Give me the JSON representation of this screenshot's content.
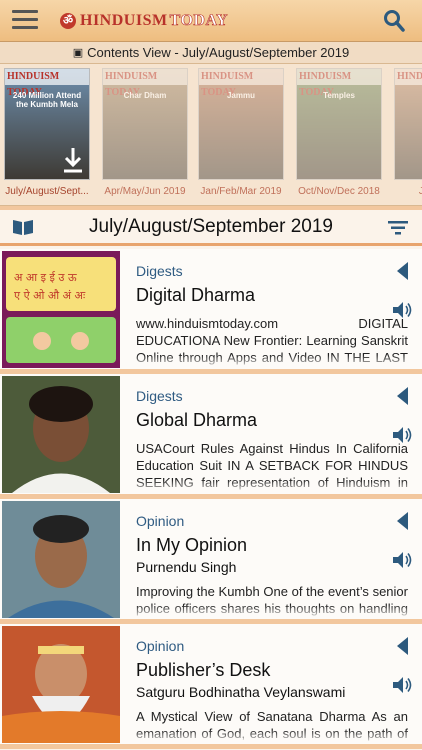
{
  "header": {
    "logo_text_1": "HINDUISM",
    "logo_text_2": "TODAY",
    "logo_mark": "ॐ",
    "menu_icon": "hamburger-icon",
    "search_icon": "search-icon"
  },
  "view_bar": {
    "label": "Contents View - July/August/September 2019",
    "icon": "monitor-icon"
  },
  "issues": [
    {
      "label": "July/August/Sept...",
      "masthead": "HINDUISM TODAY",
      "cover_title": "240 Million Attend the Kumbh Mela",
      "cover_color": "#6e8fae",
      "state": "active"
    },
    {
      "label": "Apr/May/Jun 2019",
      "masthead": "HINDUISM TODAY",
      "cover_title": "Char Dham",
      "cover_color": "#a78c6a",
      "state": "faded"
    },
    {
      "label": "Jan/Feb/Mar 2019",
      "masthead": "HINDUISM TODAY",
      "cover_title": "Jammu",
      "cover_color": "#b77a5a",
      "state": "faded"
    },
    {
      "label": "Oct/Nov/Dec 2018",
      "masthead": "HINDUISM TODAY",
      "cover_title": "Temples",
      "cover_color": "#6f8f5c",
      "state": "faded"
    },
    {
      "label": "Jul/Au...",
      "masthead": "HINDU",
      "cover_title": "",
      "cover_color": "#c09070",
      "state": "faded"
    }
  ],
  "issue_title": "July/August/September 2019",
  "articles": [
    {
      "category": "Digests",
      "title": "Digital Dharma",
      "author": "",
      "excerpt": "www.hinduismtoday.com DIGITAL EDUCATIONA New Frontier: Learning Sanskrit Online through Apps and Video IN THE LAST TEN YEARS YET AN",
      "thumb_kind": "sanskrit-app"
    },
    {
      "category": "Digests",
      "title": "Global Dharma",
      "author": "",
      "excerpt": "USACourt Rules Against Hindus In California Education Suit IN A SETBACK FOR HINDUS SEEKING fair representation of Hinduism in school text",
      "thumb_kind": "portrait-girl"
    },
    {
      "category": "Opinion",
      "title": "In My Opinion",
      "author": "Purnendu Singh",
      "excerpt": "Improving the Kumbh One of the event’s senior police officers shares his thoughts on handling large crowds",
      "thumb_kind": "portrait-man"
    },
    {
      "category": "Opinion",
      "title": "Publisher’s Desk",
      "author": "Satguru Bodhinatha Veylanswami",
      "excerpt": "A Mystical View of Sanatana Dharma As an emanation of God, each soul is on the path of self-realization",
      "thumb_kind": "portrait-guru"
    }
  ],
  "colors": {
    "accent": "#e8a46d",
    "category": "#2f5b82",
    "icon_blue": "#2d5a7e"
  }
}
